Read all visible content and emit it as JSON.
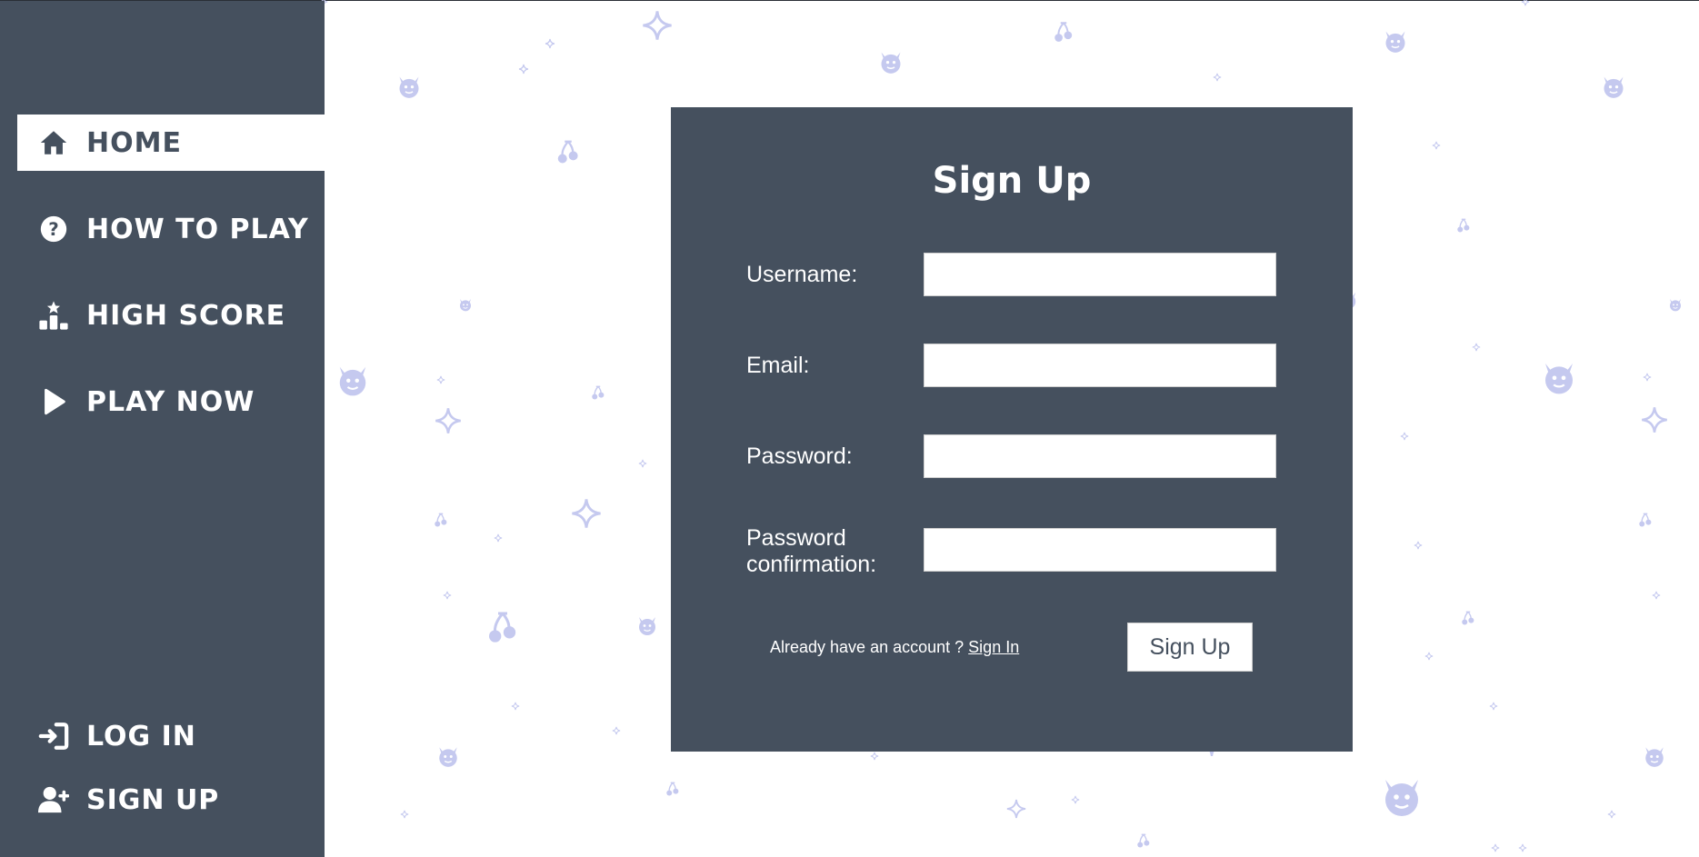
{
  "sidebar": {
    "top_items": [
      {
        "label": "HOME",
        "icon": "home-icon",
        "active": true
      },
      {
        "label": "HOW TO PLAY",
        "icon": "question-circle-icon",
        "active": false
      },
      {
        "label": "HIGH SCORE",
        "icon": "podium-icon",
        "active": false
      },
      {
        "label": "PLAY NOW",
        "icon": "play-icon",
        "active": false
      }
    ],
    "bottom_items": [
      {
        "label": "LOG IN",
        "icon": "login-icon"
      },
      {
        "label": "SIGN UP",
        "icon": "user-plus-icon"
      }
    ]
  },
  "form": {
    "title": "Sign Up",
    "fields": [
      {
        "label": "Username:",
        "value": "",
        "type": "text"
      },
      {
        "label": "Email:",
        "value": "",
        "type": "email"
      },
      {
        "label": "Password:",
        "value": "",
        "type": "password"
      },
      {
        "label": "Password confirmation:",
        "value": "",
        "type": "password"
      }
    ],
    "already_text": "Already have an account ?",
    "sign_in_link": "Sign In",
    "submit_label": "Sign Up"
  },
  "colors": {
    "sidebar_bg": "#45505e",
    "panel_bg": "#45505e",
    "decoration": "#c5c9ef",
    "text_light": "#ffffff"
  },
  "background_icons": [
    "devil-icon",
    "cherry-icon",
    "sparkle-icon"
  ]
}
